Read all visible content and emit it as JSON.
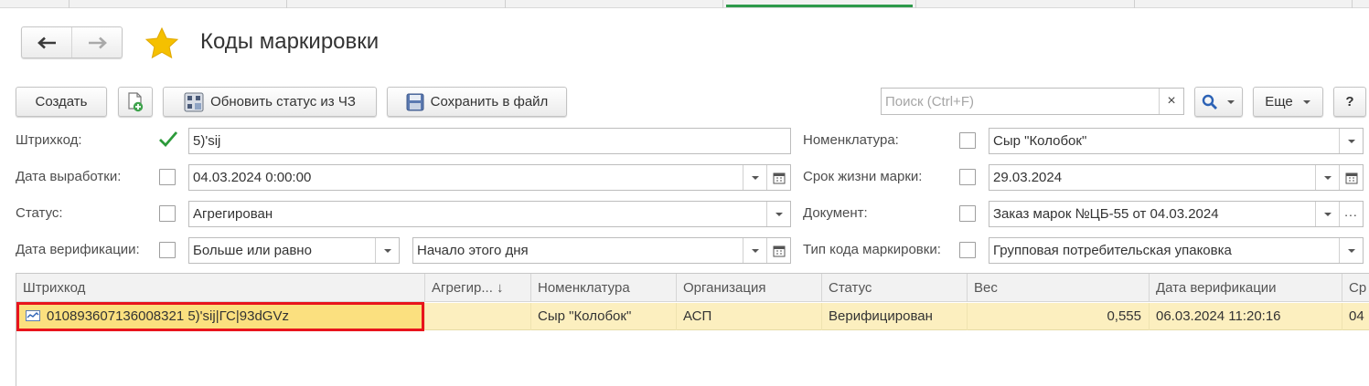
{
  "window": {
    "title": "Коды маркировки"
  },
  "toolbar": {
    "create_label": "Создать",
    "update_status_label": "Обновить статус из ЧЗ",
    "save_to_file_label": "Сохранить в файл",
    "search_placeholder": "Поиск (Ctrl+F)",
    "search_clear": "×",
    "more_label": "Еще",
    "help_label": "?"
  },
  "filters": {
    "barcode": {
      "label": "Штрихкод:",
      "checked": true,
      "value": "5)'sij"
    },
    "production_date": {
      "label": "Дата выработки:",
      "checked": false,
      "value": "04.03.2024  0:00:00"
    },
    "status": {
      "label": "Статус:",
      "checked": false,
      "value": "Агрегирован"
    },
    "verification_date": {
      "label": "Дата верификации:",
      "checked": false,
      "condition": "Больше или равно",
      "value": "Начало этого дня"
    },
    "nomenclature": {
      "label": "Номенклатура:",
      "checked": false,
      "value": "Сыр \"Колобок\""
    },
    "mark_lifetime": {
      "label": "Срок жизни марки:",
      "checked": false,
      "value": "29.03.2024"
    },
    "document": {
      "label": "Документ:",
      "checked": false,
      "value": "Заказ марок №ЦБ-55 от 04.03.2024",
      "more": "..."
    },
    "mark_code_type": {
      "label": "Тип кода маркировки:",
      "checked": false,
      "value": "Групповая потребительская упаковка"
    }
  },
  "table": {
    "columns": [
      "Штрихкод",
      "Агрегир... ↓",
      "Номенклатура",
      "Организация",
      "Статус",
      "Вес",
      "Дата верификации",
      "Ср"
    ],
    "rows": [
      {
        "barcode": "010893607136008321 5)'sij|ГС|93dGVz",
        "aggregation": "",
        "nomenclature": "Сыр \"Колобок\"",
        "organization": "АСП",
        "status": "Верифицирован",
        "weight": "0,555",
        "verification_date": "06.03.2024 11:20:16",
        "extra": "04"
      }
    ]
  },
  "colors": {
    "accent_star": "#f5c000",
    "active_tab": "#2e9a4b",
    "selected_row": "#fcefbf",
    "highlight_box": "#e8141c"
  },
  "icons": [
    "back-arrow-icon",
    "forward-arrow-icon",
    "favorite-star-icon",
    "add-copy-icon",
    "update-status-icon",
    "save-floppy-icon",
    "search-icon",
    "checkmark-icon",
    "calendar-icon",
    "barcode-row-icon"
  ]
}
